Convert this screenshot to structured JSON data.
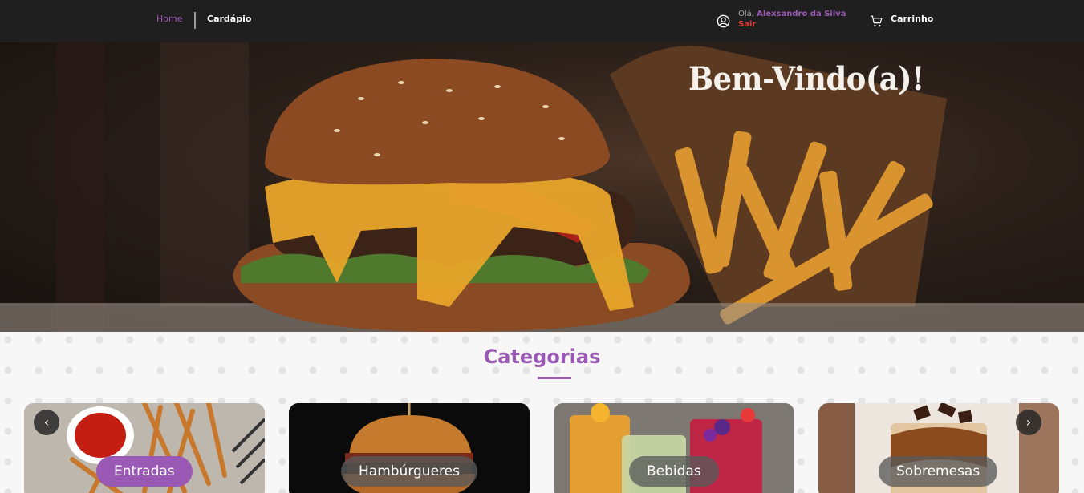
{
  "header": {
    "nav": {
      "home": "Home",
      "menu": "Cardápio"
    },
    "user": {
      "greeting": "Olá,",
      "name": "Alexsandro da Silva",
      "logout": "Sair"
    },
    "cart": {
      "label": "Carrinho"
    }
  },
  "hero": {
    "title": "Bem-Vindo(a)!"
  },
  "categories": {
    "title": "Categorias",
    "items": [
      {
        "label": "Entradas"
      },
      {
        "label": "Hambúrgueres"
      },
      {
        "label": "Bebidas"
      },
      {
        "label": "Sobremesas"
      }
    ],
    "prev_icon": "‹",
    "next_icon": "›"
  },
  "colors": {
    "accent": "#9b59b6",
    "header_bg": "#1f1f1f",
    "logout": "#e53935"
  },
  "icons": {
    "user": "user-circle-icon",
    "cart": "shopping-cart-icon",
    "prev": "chevron-left-icon",
    "next": "chevron-right-icon"
  }
}
